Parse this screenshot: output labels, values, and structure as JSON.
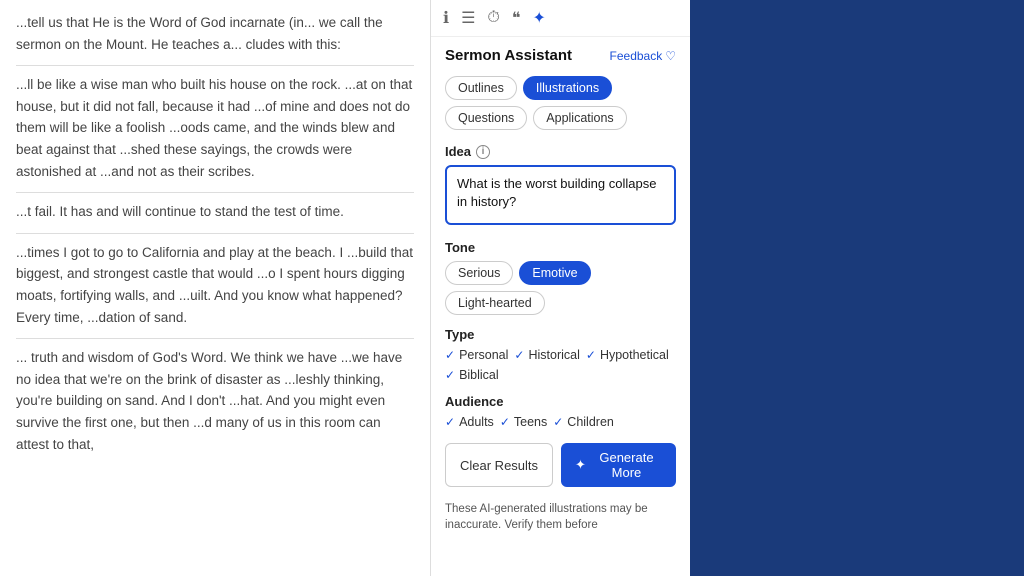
{
  "textPanel": {
    "paragraphs": [
      "...tell us that He is the Word of God incarnate (in... we call the sermon on the Mount. He teaches a... cludes with this:",
      "...ll be like a wise man who built his house on the rock. ...at on that house, but it did not fall, because it had ...of mine and does not do them will be like a foolish ...oods came, and the winds blew and beat against that ...shed these sayings, the crowds were astonished at ...and not as their scribes.",
      "...t fail. It has and will continue to stand the test of time.",
      "...times I got to go to California and play at the beach. I ...build that biggest, and strongest castle that would ...o I spent hours digging moats, fortifying walls, and ...uilt. And you know what happened? Every time, ...dation of sand.",
      "... truth and wisdom of God's Word. We think we have ...we have no idea that we're on the brink of disaster as ...leshly thinking, you're building on sand. And I don't ...hat. And you might even survive the first one, but then ...d many of us in this room can attest to that,"
    ]
  },
  "toolbar": {
    "icons": [
      "ℹ",
      "☰",
      "⏱",
      "❝",
      "✦"
    ],
    "activeIcon": 4
  },
  "header": {
    "title": "Sermon Assistant",
    "feedbackLabel": "Feedback",
    "feedbackIcon": "♡"
  },
  "tabs": [
    {
      "label": "Outlines",
      "active": false
    },
    {
      "label": "Illustrations",
      "active": true
    },
    {
      "label": "Questions",
      "active": false
    },
    {
      "label": "Applications",
      "active": false
    }
  ],
  "idea": {
    "label": "Idea",
    "placeholder": "",
    "value": "What is the worst building collapse in history?"
  },
  "tone": {
    "label": "Tone",
    "options": [
      {
        "label": "Serious",
        "active": false
      },
      {
        "label": "Emotive",
        "active": true
      },
      {
        "label": "Light-hearted",
        "active": false
      }
    ]
  },
  "type": {
    "label": "Type",
    "options": [
      {
        "label": "Personal",
        "checked": true
      },
      {
        "label": "Historical",
        "checked": true
      },
      {
        "label": "Hypothetical",
        "checked": true
      },
      {
        "label": "Biblical",
        "checked": true
      }
    ]
  },
  "audience": {
    "label": "Audience",
    "options": [
      {
        "label": "Adults",
        "checked": true
      },
      {
        "label": "Teens",
        "checked": true
      },
      {
        "label": "Children",
        "checked": true
      }
    ]
  },
  "actions": {
    "clearLabel": "Clear Results",
    "generateLabel": "Generate More",
    "generateIcon": "✦"
  },
  "disclaimer": "These AI-generated illustrations may be inaccurate. Verify them before"
}
